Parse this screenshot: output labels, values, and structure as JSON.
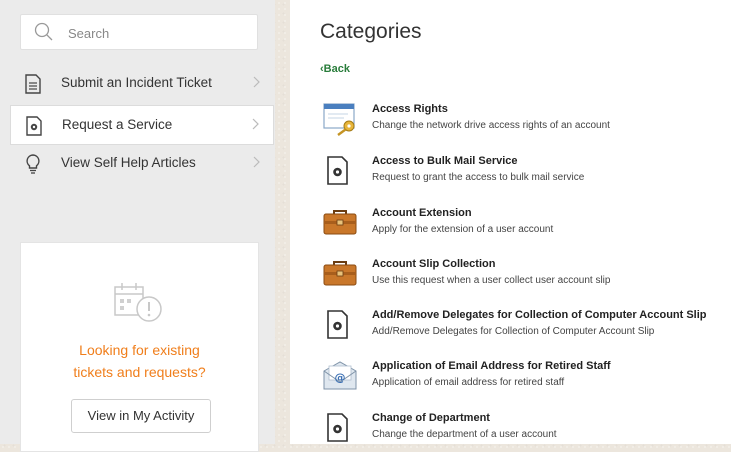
{
  "sidebar": {
    "search_placeholder": "Search",
    "items": [
      {
        "label": "Submit an Incident Ticket",
        "icon": "document-icon"
      },
      {
        "label": "Request a Service",
        "icon": "service-request-icon"
      },
      {
        "label": "View Self Help Articles",
        "icon": "lightbulb-icon"
      }
    ]
  },
  "activity_card": {
    "message_line1": "Looking for existing",
    "message_line2": "tickets and requests?",
    "button_label": "View in My Activity",
    "accent_color": "#f07e1b"
  },
  "main": {
    "title": "Categories",
    "back_label": "Back",
    "categories": [
      {
        "name": "Access Rights",
        "description": "Change the network drive access rights of an account",
        "icon": "key-window-icon"
      },
      {
        "name": "Access to Bulk Mail Service",
        "description": "Request to grant the access to bulk mail service",
        "icon": "service-doc-icon"
      },
      {
        "name": "Account Extension",
        "description": "Apply for the extension of a user account",
        "icon": "briefcase-icon"
      },
      {
        "name": "Account Slip Collection",
        "description": "Use this request when a user collect user account slip",
        "icon": "briefcase-icon"
      },
      {
        "name": "Add/Remove Delegates for Collection of Computer Account Slip",
        "description": "Add/Remove Delegates for Collection of Computer Account Slip",
        "icon": "service-doc-icon"
      },
      {
        "name": "Application of Email Address for Retired Staff",
        "description": "Application of email address for retired staff",
        "icon": "email-envelope-icon"
      },
      {
        "name": "Change of Department",
        "description": "Change the department of a user account",
        "icon": "service-doc-icon"
      }
    ]
  }
}
